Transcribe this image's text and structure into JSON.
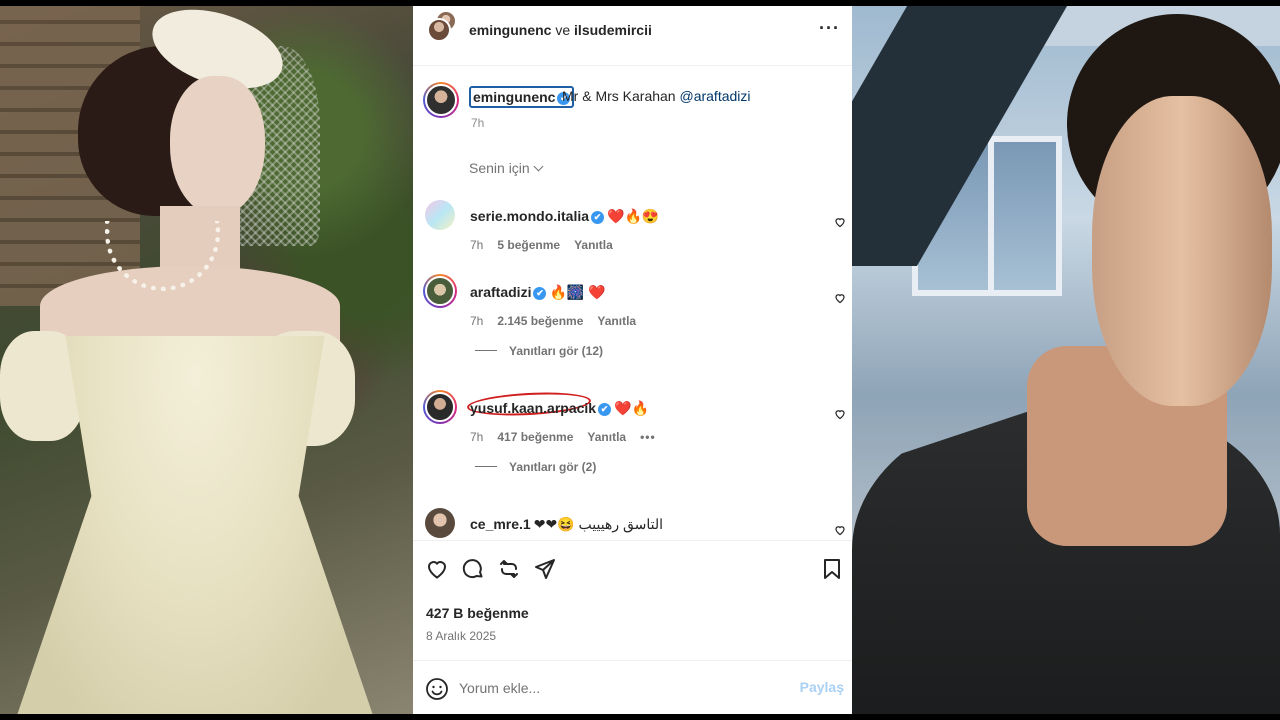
{
  "post": {
    "header": {
      "user1": "emingunenc",
      "connector": "ve",
      "user2": "ilsudemircii",
      "more_icon": "more-horizontal-icon"
    },
    "caption": {
      "username": "emingunenc",
      "verified": "✔",
      "text": "Mr & Mrs Karahan ",
      "mention": "@araftadizi",
      "time": "7h"
    },
    "for_you_label": "Senin için",
    "comments": [
      {
        "username": "serie.mondo.italia",
        "verified": "✔",
        "text": "❤️🔥😍",
        "time": "7h",
        "likes": "5 beğenme",
        "reply": "Yanıtla"
      },
      {
        "username": "araftadizi",
        "verified": "✔",
        "text": "🔥🎆 ❤️",
        "time": "7h",
        "likes": "2.145 beğenme",
        "reply": "Yanıtla",
        "view_replies": "Yanıtları gör (12)"
      },
      {
        "username": "yusuf.kaan.arpacik",
        "verified": "✔",
        "text": "❤️🔥",
        "time": "7h",
        "likes": "417 beğenme",
        "reply": "Yanıtla",
        "more": "•••",
        "view_replies": "Yanıtları gör (2)"
      },
      {
        "username": "ce_mre.1",
        "text": "❤❤😆 التاسق رهيييب"
      }
    ],
    "likes_total": "427 B beğenme",
    "date": "8 Aralık 2025",
    "composer": {
      "placeholder": "Yorum ekle...",
      "post_label": "Paylaş"
    },
    "colors": {
      "verified": "#3897f0",
      "link": "#00376b",
      "post_button": "#a9d0f5",
      "annotation": "#d01e1e"
    }
  }
}
